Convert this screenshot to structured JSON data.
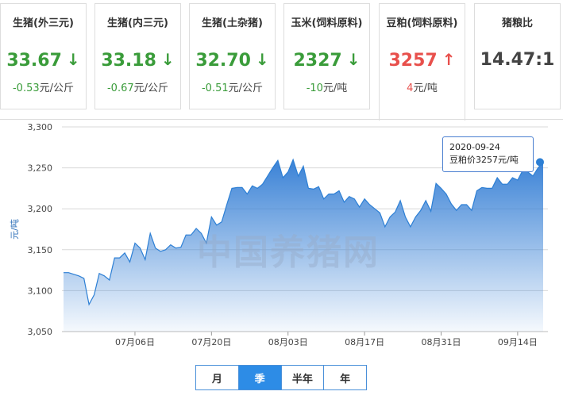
{
  "cards": [
    {
      "title": "生猪(外三元)",
      "price": "33.67",
      "arrow": "↓",
      "direction": "down",
      "change": "-0.53",
      "unit": "元/公斤"
    },
    {
      "title": "生猪(内三元)",
      "price": "33.18",
      "arrow": "↓",
      "direction": "down",
      "change": "-0.67",
      "unit": "元/公斤"
    },
    {
      "title": "生猪(土杂猪)",
      "price": "32.70",
      "arrow": "↓",
      "direction": "down",
      "change": "-0.51",
      "unit": "元/公斤"
    },
    {
      "title": "玉米(饲料原料)",
      "price": "2327",
      "arrow": "↓",
      "direction": "down",
      "change": "-10",
      "unit": "元/吨"
    },
    {
      "title": "豆粕(饲料原料)",
      "price": "3257",
      "arrow": "↑",
      "direction": "up",
      "change": "4",
      "unit": "元/吨"
    },
    {
      "title": "猪粮比",
      "price": "14.47:1",
      "arrow": "",
      "direction": "neutral",
      "change": "",
      "unit": ""
    }
  ],
  "tooltip": {
    "date": "2020-09-24",
    "label": "豆粕价3257元/吨"
  },
  "watermark": "中国养猪网",
  "range_buttons": [
    "月",
    "季",
    "半年",
    "年"
  ],
  "colors": {
    "up": "#e8504c",
    "down": "#3a9c3a",
    "series": "#2d7fd4",
    "active_button": "#2d8ce6"
  },
  "chart_data": {
    "type": "area",
    "ylabel": "元/吨",
    "ylim": [
      3050,
      3300
    ],
    "yticks": [
      "3,050",
      "3,100",
      "3,150",
      "3,200",
      "3,250",
      "3,300"
    ],
    "xticks": [
      "07月06日",
      "07月20日",
      "08月03日",
      "08月17日",
      "08月31日",
      "09月14日"
    ],
    "grid": true,
    "series": [
      {
        "values": [
          3122,
          3122,
          3120,
          3118,
          3115,
          3083,
          3095,
          3121,
          3118,
          3113,
          3140,
          3140,
          3146,
          3135,
          3158,
          3152,
          3138,
          3170,
          3152,
          3148,
          3150,
          3156,
          3152,
          3153,
          3168,
          3168,
          3176,
          3170,
          3158,
          3190,
          3180,
          3184,
          3205,
          3225,
          3226,
          3226,
          3218,
          3228,
          3225,
          3230,
          3240,
          3250,
          3259,
          3238,
          3245,
          3260,
          3240,
          3252,
          3225,
          3224,
          3227,
          3212,
          3218,
          3218,
          3222,
          3208,
          3215,
          3212,
          3202,
          3212,
          3205,
          3200,
          3195,
          3178,
          3190,
          3196,
          3210,
          3190,
          3178,
          3190,
          3198,
          3210,
          3197,
          3231,
          3225,
          3218,
          3206,
          3198,
          3205,
          3205,
          3198,
          3222,
          3226,
          3225,
          3225,
          3238,
          3230,
          3230,
          3238,
          3235,
          3247,
          3245,
          3240,
          3250,
          3257
        ]
      }
    ]
  }
}
